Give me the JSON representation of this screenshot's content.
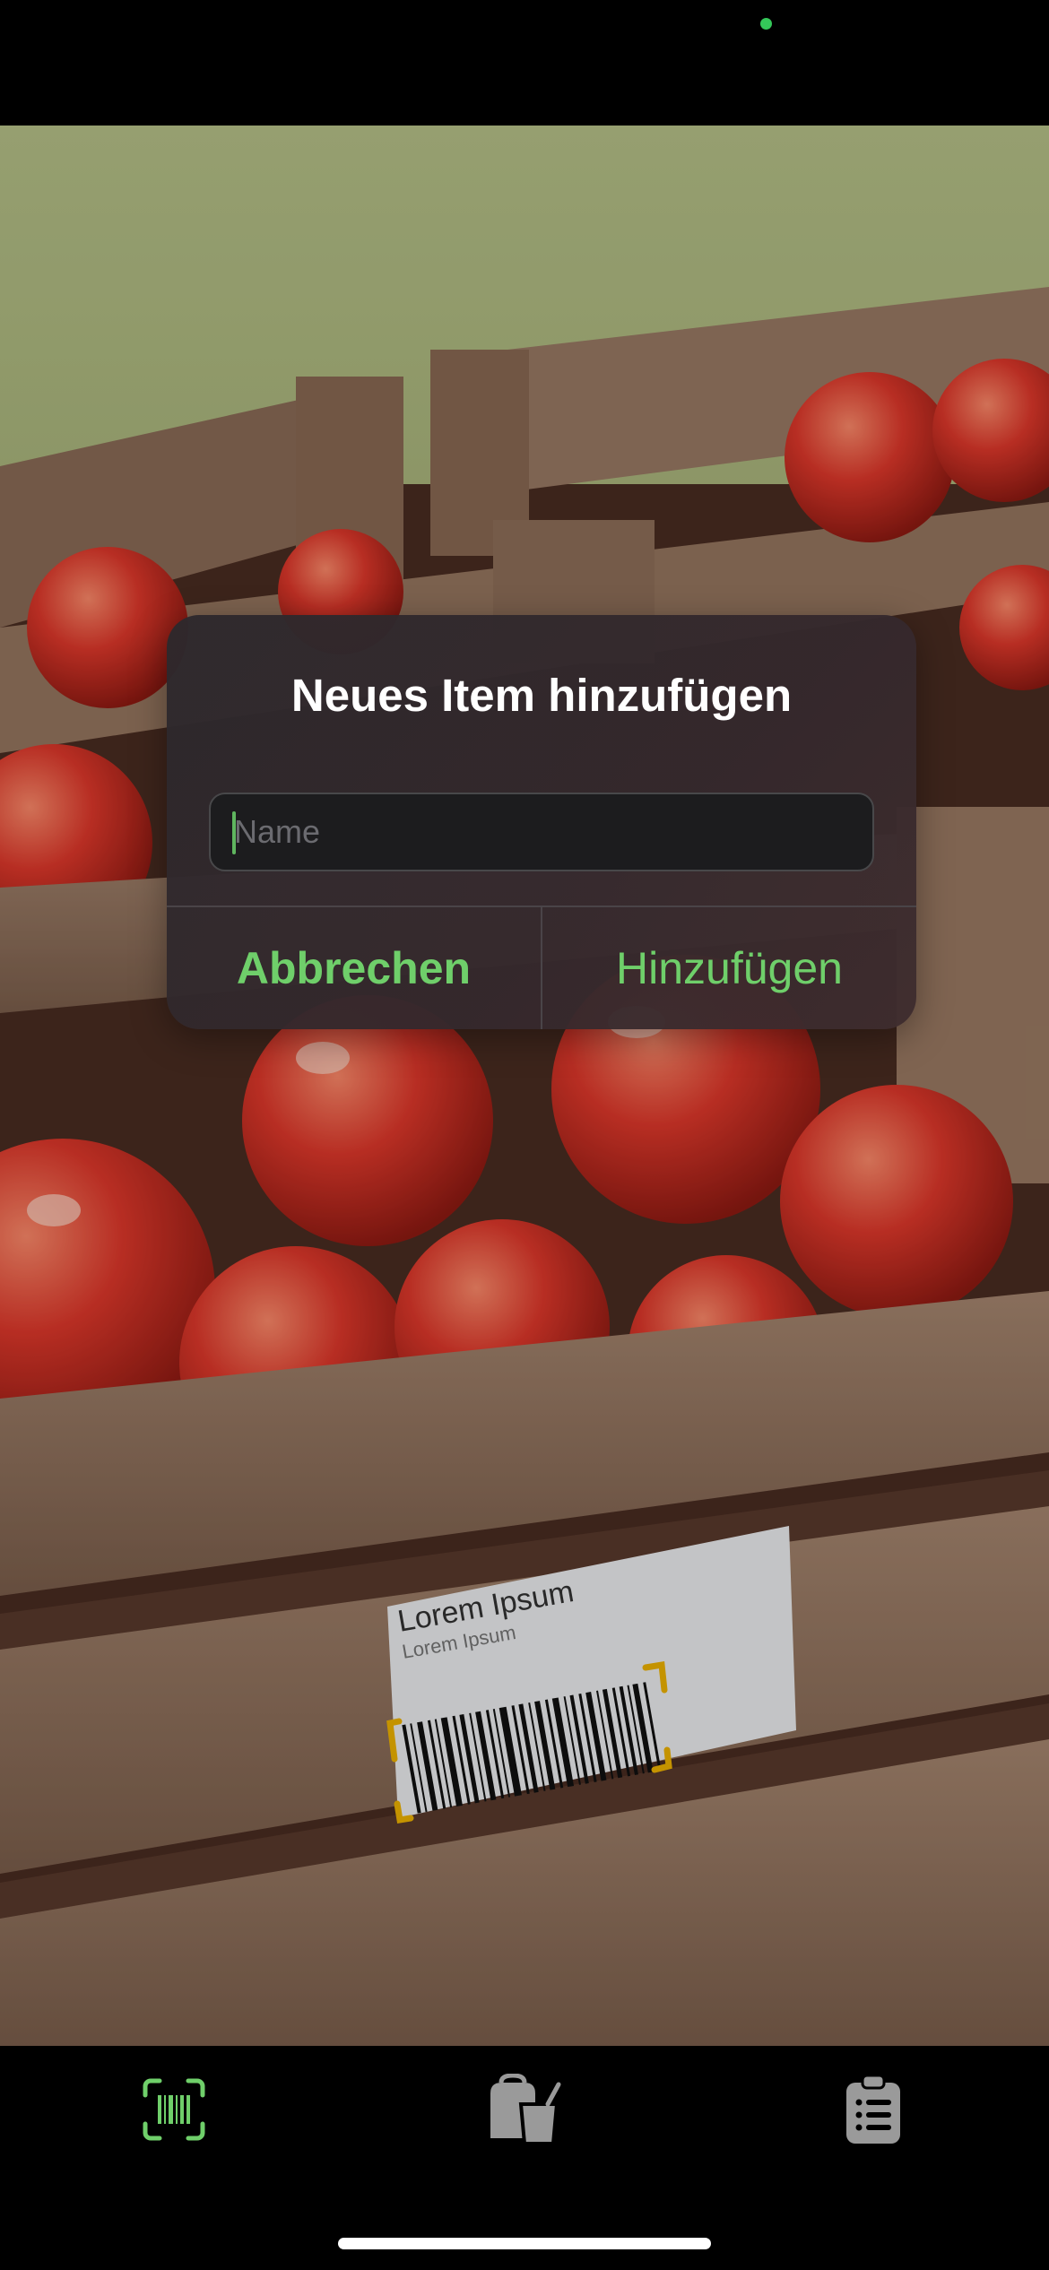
{
  "dialog": {
    "title": "Neues Item hinzufügen",
    "name_placeholder": "Name",
    "name_value": "",
    "cancel_label": "Abbrechen",
    "add_label": "Hinzufügen"
  },
  "camera": {
    "label_title": "Lorem Ipsum",
    "label_subtitle": "Lorem Ipsum"
  },
  "tab_bar": {
    "tabs": [
      {
        "name": "scanner",
        "icon": "barcode-viewfinder-icon",
        "active": true
      },
      {
        "name": "items",
        "icon": "shopping-bags-icon",
        "active": false
      },
      {
        "name": "list",
        "icon": "clipboard-list-icon",
        "active": false
      }
    ]
  },
  "colors": {
    "accent": "#6fcf6a",
    "inactive_icon": "#9a9a9a",
    "scan_corner": "#f0b400"
  }
}
